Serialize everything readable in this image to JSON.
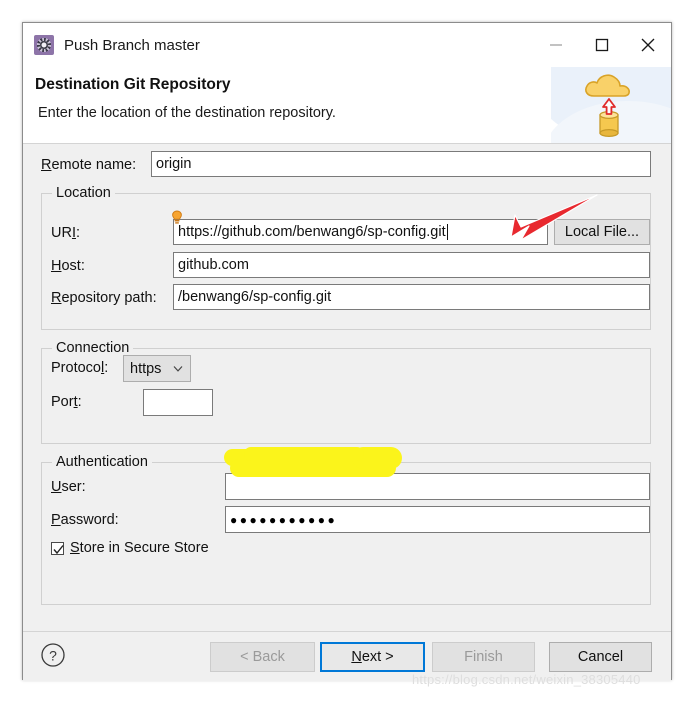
{
  "window": {
    "title": "Push Branch master",
    "icon": "eclipse-gear-icon",
    "controls": {
      "minimize": "–",
      "maximize": "□",
      "close": "✕"
    }
  },
  "banner": {
    "title": "Destination Git Repository",
    "subtitle": "Enter the location of the destination repository.",
    "art_icon": "cloud-upload-database-icon"
  },
  "form": {
    "remote_name": {
      "label": "Remote name:",
      "mnemonic": "R",
      "value": "origin"
    },
    "location": {
      "group_title": "Location",
      "uri": {
        "label": "URI:",
        "mnemonic": "I",
        "value": "https://github.com/benwang6/sp-config.git",
        "decoration_icon": "lightbulb-hint-icon"
      },
      "local_file_button": "Local File...",
      "host": {
        "label": "Host:",
        "mnemonic": "H",
        "value": "github.com"
      },
      "repository_path": {
        "label": "Repository path:",
        "mnemonic": "R",
        "value": "/benwang6/sp-config.git"
      }
    },
    "connection": {
      "group_title": "Connection",
      "protocol": {
        "label": "Protocol:",
        "mnemonic": "l",
        "value": "https"
      },
      "port": {
        "label": "Port:",
        "mnemonic": "t",
        "value": ""
      }
    },
    "authentication": {
      "group_title": "Authentication",
      "user": {
        "label": "User:",
        "mnemonic": "U",
        "value": "",
        "redacted": true
      },
      "password": {
        "label": "Password:",
        "mnemonic": "P",
        "value": "●●●●●●●●●●●"
      },
      "store_secure": {
        "label": "Store in Secure Store",
        "mnemonic": "S",
        "checked": true
      }
    }
  },
  "footer": {
    "help_icon": "help-question-icon",
    "back_button": "< Back",
    "next_button": "Next >",
    "finish_button": "Finish",
    "cancel_button": "Cancel"
  },
  "annotations": {
    "arrow_icon": "red-arrow-pointing-to-uri",
    "watermark": "https://blog.csdn.net/weixin_38305440"
  },
  "colors": {
    "accent": "#0078d7",
    "redaction": "#fbf41b",
    "arrow": "#e8292f",
    "dialog_bg": "#f0f0f0"
  }
}
